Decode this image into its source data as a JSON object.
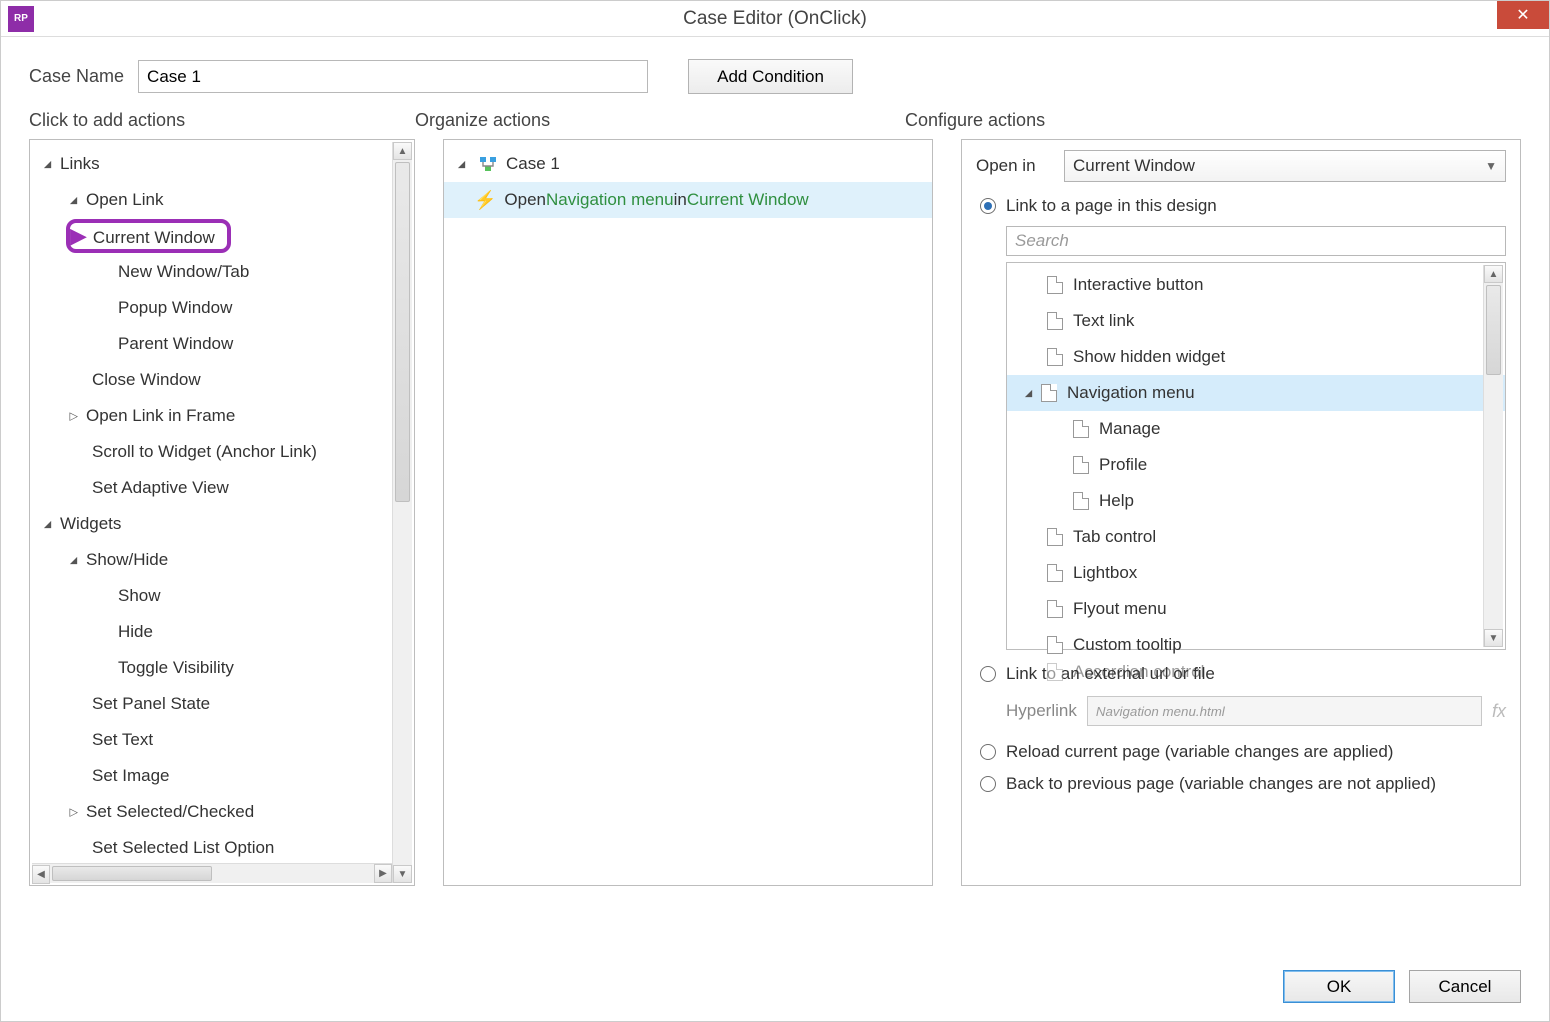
{
  "window": {
    "title": "Case Editor (OnClick)"
  },
  "caseName": {
    "label": "Case Name",
    "value": "Case 1"
  },
  "addConditionLabel": "Add Condition",
  "columns": {
    "left": "Click to add actions",
    "mid": "Organize actions",
    "right": "Configure actions"
  },
  "actionsTree": {
    "links": "Links",
    "openLink": "Open Link",
    "currentWindow": "Current Window",
    "newWindow": "New Window/Tab",
    "popupWindow": "Popup Window",
    "parentWindow": "Parent Window",
    "closeWindow": "Close Window",
    "openLinkInFrame": "Open Link in Frame",
    "scrollToWidget": "Scroll to Widget (Anchor Link)",
    "setAdaptiveView": "Set Adaptive View",
    "widgets": "Widgets",
    "showHide": "Show/Hide",
    "show": "Show",
    "hide": "Hide",
    "toggleVisibility": "Toggle Visibility",
    "setPanelState": "Set Panel State",
    "setText": "Set Text",
    "setImage": "Set Image",
    "setSelectedChecked": "Set Selected/Checked",
    "setSelectedListOption": "Set Selected List Option"
  },
  "organize": {
    "caseLabel": "Case 1",
    "action_prefix": "Open ",
    "action_link": "Navigation menu",
    "action_mid": " in ",
    "action_target": "Current Window"
  },
  "configure": {
    "openInLabel": "Open in",
    "openInValue": "Current Window",
    "radio_linkPage": "Link to a page in this design",
    "searchPlaceholder": "Search",
    "pages": {
      "interactiveButton": "Interactive button",
      "textLink": "Text link",
      "showHiddenWidget": "Show hidden widget",
      "navigationMenu": "Navigation menu",
      "manage": "Manage",
      "profile": "Profile",
      "help": "Help",
      "tabControl": "Tab control",
      "lightbox": "Lightbox",
      "flyoutMenu": "Flyout menu",
      "customTooltip": "Custom tooltip",
      "accordionControl": "Accordion control"
    },
    "radio_external": "Link to an external url or file",
    "hyperlinkLabel": "Hyperlink",
    "hyperlinkValue": "Navigation menu.html",
    "radio_reload": "Reload current page (variable changes are applied)",
    "radio_back": "Back to previous page (variable changes are not applied)"
  },
  "footer": {
    "ok": "OK",
    "cancel": "Cancel"
  }
}
